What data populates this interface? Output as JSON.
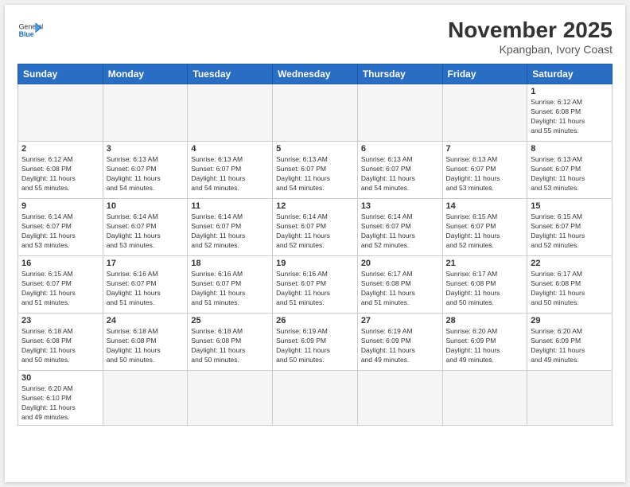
{
  "header": {
    "title": "November 2025",
    "location": "Kpangban, Ivory Coast",
    "logo_general": "General",
    "logo_blue": "Blue"
  },
  "weekdays": [
    "Sunday",
    "Monday",
    "Tuesday",
    "Wednesday",
    "Thursday",
    "Friday",
    "Saturday"
  ],
  "weeks": [
    [
      {
        "day": "",
        "info": ""
      },
      {
        "day": "",
        "info": ""
      },
      {
        "day": "",
        "info": ""
      },
      {
        "day": "",
        "info": ""
      },
      {
        "day": "",
        "info": ""
      },
      {
        "day": "",
        "info": ""
      },
      {
        "day": "1",
        "info": "Sunrise: 6:12 AM\nSunset: 6:08 PM\nDaylight: 11 hours\nand 55 minutes."
      }
    ],
    [
      {
        "day": "2",
        "info": "Sunrise: 6:12 AM\nSunset: 6:08 PM\nDaylight: 11 hours\nand 55 minutes."
      },
      {
        "day": "3",
        "info": "Sunrise: 6:13 AM\nSunset: 6:07 PM\nDaylight: 11 hours\nand 54 minutes."
      },
      {
        "day": "4",
        "info": "Sunrise: 6:13 AM\nSunset: 6:07 PM\nDaylight: 11 hours\nand 54 minutes."
      },
      {
        "day": "5",
        "info": "Sunrise: 6:13 AM\nSunset: 6:07 PM\nDaylight: 11 hours\nand 54 minutes."
      },
      {
        "day": "6",
        "info": "Sunrise: 6:13 AM\nSunset: 6:07 PM\nDaylight: 11 hours\nand 54 minutes."
      },
      {
        "day": "7",
        "info": "Sunrise: 6:13 AM\nSunset: 6:07 PM\nDaylight: 11 hours\nand 53 minutes."
      },
      {
        "day": "8",
        "info": "Sunrise: 6:13 AM\nSunset: 6:07 PM\nDaylight: 11 hours\nand 53 minutes."
      }
    ],
    [
      {
        "day": "9",
        "info": "Sunrise: 6:14 AM\nSunset: 6:07 PM\nDaylight: 11 hours\nand 53 minutes."
      },
      {
        "day": "10",
        "info": "Sunrise: 6:14 AM\nSunset: 6:07 PM\nDaylight: 11 hours\nand 53 minutes."
      },
      {
        "day": "11",
        "info": "Sunrise: 6:14 AM\nSunset: 6:07 PM\nDaylight: 11 hours\nand 52 minutes."
      },
      {
        "day": "12",
        "info": "Sunrise: 6:14 AM\nSunset: 6:07 PM\nDaylight: 11 hours\nand 52 minutes."
      },
      {
        "day": "13",
        "info": "Sunrise: 6:14 AM\nSunset: 6:07 PM\nDaylight: 11 hours\nand 52 minutes."
      },
      {
        "day": "14",
        "info": "Sunrise: 6:15 AM\nSunset: 6:07 PM\nDaylight: 11 hours\nand 52 minutes."
      },
      {
        "day": "15",
        "info": "Sunrise: 6:15 AM\nSunset: 6:07 PM\nDaylight: 11 hours\nand 52 minutes."
      }
    ],
    [
      {
        "day": "16",
        "info": "Sunrise: 6:15 AM\nSunset: 6:07 PM\nDaylight: 11 hours\nand 51 minutes."
      },
      {
        "day": "17",
        "info": "Sunrise: 6:16 AM\nSunset: 6:07 PM\nDaylight: 11 hours\nand 51 minutes."
      },
      {
        "day": "18",
        "info": "Sunrise: 6:16 AM\nSunset: 6:07 PM\nDaylight: 11 hours\nand 51 minutes."
      },
      {
        "day": "19",
        "info": "Sunrise: 6:16 AM\nSunset: 6:07 PM\nDaylight: 11 hours\nand 51 minutes."
      },
      {
        "day": "20",
        "info": "Sunrise: 6:17 AM\nSunset: 6:08 PM\nDaylight: 11 hours\nand 51 minutes."
      },
      {
        "day": "21",
        "info": "Sunrise: 6:17 AM\nSunset: 6:08 PM\nDaylight: 11 hours\nand 50 minutes."
      },
      {
        "day": "22",
        "info": "Sunrise: 6:17 AM\nSunset: 6:08 PM\nDaylight: 11 hours\nand 50 minutes."
      }
    ],
    [
      {
        "day": "23",
        "info": "Sunrise: 6:18 AM\nSunset: 6:08 PM\nDaylight: 11 hours\nand 50 minutes."
      },
      {
        "day": "24",
        "info": "Sunrise: 6:18 AM\nSunset: 6:08 PM\nDaylight: 11 hours\nand 50 minutes."
      },
      {
        "day": "25",
        "info": "Sunrise: 6:18 AM\nSunset: 6:08 PM\nDaylight: 11 hours\nand 50 minutes."
      },
      {
        "day": "26",
        "info": "Sunrise: 6:19 AM\nSunset: 6:09 PM\nDaylight: 11 hours\nand 50 minutes."
      },
      {
        "day": "27",
        "info": "Sunrise: 6:19 AM\nSunset: 6:09 PM\nDaylight: 11 hours\nand 49 minutes."
      },
      {
        "day": "28",
        "info": "Sunrise: 6:20 AM\nSunset: 6:09 PM\nDaylight: 11 hours\nand 49 minutes."
      },
      {
        "day": "29",
        "info": "Sunrise: 6:20 AM\nSunset: 6:09 PM\nDaylight: 11 hours\nand 49 minutes."
      }
    ],
    [
      {
        "day": "30",
        "info": "Sunrise: 6:20 AM\nSunset: 6:10 PM\nDaylight: 11 hours\nand 49 minutes."
      },
      {
        "day": "",
        "info": ""
      },
      {
        "day": "",
        "info": ""
      },
      {
        "day": "",
        "info": ""
      },
      {
        "day": "",
        "info": ""
      },
      {
        "day": "",
        "info": ""
      },
      {
        "day": "",
        "info": ""
      }
    ]
  ]
}
